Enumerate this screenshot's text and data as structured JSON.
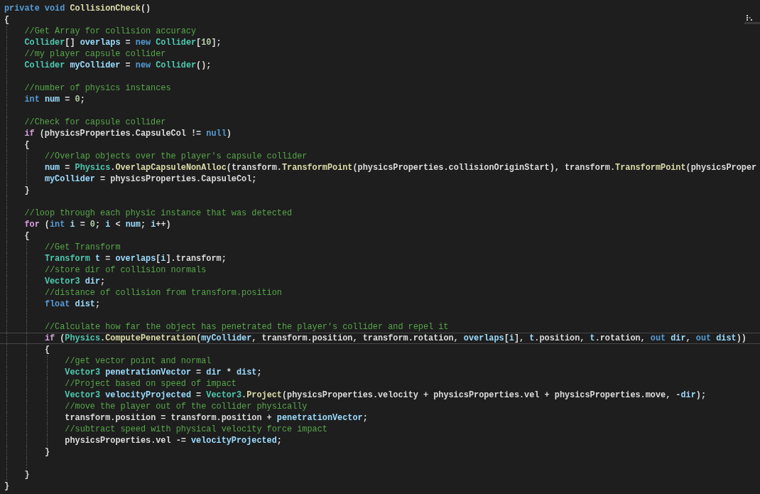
{
  "editor": {
    "lines": [
      {
        "current": false,
        "tokens": [
          {
            "kind": "keyword",
            "text": "private void "
          },
          {
            "kind": "method",
            "text": "CollisionCheck"
          },
          {
            "kind": "plain",
            "text": "()"
          }
        ]
      },
      {
        "current": false,
        "tokens": [
          {
            "kind": "plain",
            "text": "{"
          }
        ],
        "children": [
          {
            "current": false,
            "tokens": [
              {
                "kind": "comment",
                "text": "//Get Array for collision accuracy"
              }
            ]
          },
          {
            "current": false,
            "tokens": [
              {
                "kind": "type",
                "text": "Collider"
              },
              {
                "kind": "plain",
                "text": "[] "
              },
              {
                "kind": "variable",
                "text": "overlaps"
              },
              {
                "kind": "plain",
                "text": " = "
              },
              {
                "kind": "keyword",
                "text": "new "
              },
              {
                "kind": "type",
                "text": "Collider"
              },
              {
                "kind": "plain",
                "text": "["
              },
              {
                "kind": "number",
                "text": "10"
              },
              {
                "kind": "plain",
                "text": "];"
              }
            ]
          },
          {
            "current": false,
            "tokens": [
              {
                "kind": "comment",
                "text": "//my player capsule collider"
              }
            ]
          },
          {
            "current": false,
            "tokens": [
              {
                "kind": "type",
                "text": "Collider "
              },
              {
                "kind": "variable",
                "text": "myCollider"
              },
              {
                "kind": "plain",
                "text": " = "
              },
              {
                "kind": "keyword",
                "text": "new "
              },
              {
                "kind": "type",
                "text": "Collider"
              },
              {
                "kind": "plain",
                "text": "();"
              }
            ]
          },
          {
            "current": false
          },
          {
            "current": false,
            "tokens": [
              {
                "kind": "comment",
                "text": "//number of physics instances"
              }
            ]
          },
          {
            "current": false,
            "tokens": [
              {
                "kind": "keyword",
                "text": "int "
              },
              {
                "kind": "variable",
                "text": "num"
              },
              {
                "kind": "plain",
                "text": " = "
              },
              {
                "kind": "number",
                "text": "0"
              },
              {
                "kind": "plain",
                "text": ";"
              }
            ]
          },
          {
            "current": false
          },
          {
            "current": false,
            "tokens": [
              {
                "kind": "comment",
                "text": "//Check for capsule collider"
              }
            ]
          },
          {
            "current": false,
            "tokens": [
              {
                "kind": "control",
                "text": "if"
              },
              {
                "kind": "plain",
                "text": " (physicsProperties.CapsuleCol != "
              },
              {
                "kind": "keyword",
                "text": "null"
              },
              {
                "kind": "plain",
                "text": ")"
              }
            ]
          },
          {
            "current": false,
            "tokens": [
              {
                "kind": "plain",
                "text": "{"
              }
            ],
            "children": [
              {
                "current": false,
                "tokens": [
                  {
                    "kind": "comment",
                    "text": "//Overlap objects over the player's capsule collider"
                  }
                ]
              },
              {
                "current": false,
                "tokens": [
                  {
                    "kind": "variable",
                    "text": "num"
                  },
                  {
                    "kind": "plain",
                    "text": " = "
                  },
                  {
                    "kind": "type",
                    "text": "Physics"
                  },
                  {
                    "kind": "plain",
                    "text": "."
                  },
                  {
                    "kind": "method",
                    "text": "OverlapCapsuleNonAlloc"
                  },
                  {
                    "kind": "plain",
                    "text": "(transform."
                  },
                  {
                    "kind": "method",
                    "text": "TransformPoint"
                  },
                  {
                    "kind": "plain",
                    "text": "(physicsProperties.collisionOriginStart), transform."
                  },
                  {
                    "kind": "method",
                    "text": "TransformPoint"
                  },
                  {
                    "kind": "plain",
                    "text": "(physicsProper"
                  }
                ]
              },
              {
                "current": false,
                "tokens": [
                  {
                    "kind": "variable",
                    "text": "myCollider"
                  },
                  {
                    "kind": "plain",
                    "text": " = physicsProperties.CapsuleCol;"
                  }
                ]
              }
            ]
          },
          {
            "current": false,
            "tokens": [
              {
                "kind": "plain",
                "text": "}"
              }
            ]
          },
          {
            "current": false
          },
          {
            "current": false,
            "tokens": [
              {
                "kind": "comment",
                "text": "//loop through each physic instance that was detected"
              }
            ]
          },
          {
            "current": false,
            "tokens": [
              {
                "kind": "control",
                "text": "for"
              },
              {
                "kind": "plain",
                "text": " ("
              },
              {
                "kind": "keyword",
                "text": "int "
              },
              {
                "kind": "variable",
                "text": "i"
              },
              {
                "kind": "plain",
                "text": " = "
              },
              {
                "kind": "number",
                "text": "0"
              },
              {
                "kind": "plain",
                "text": "; "
              },
              {
                "kind": "variable",
                "text": "i"
              },
              {
                "kind": "plain",
                "text": " < "
              },
              {
                "kind": "variable",
                "text": "num"
              },
              {
                "kind": "plain",
                "text": "; "
              },
              {
                "kind": "variable",
                "text": "i"
              },
              {
                "kind": "plain",
                "text": "++)"
              }
            ]
          },
          {
            "current": false,
            "tokens": [
              {
                "kind": "plain",
                "text": "{"
              }
            ],
            "children": [
              {
                "current": false,
                "tokens": [
                  {
                    "kind": "comment",
                    "text": "//Get Transform"
                  }
                ]
              },
              {
                "current": false,
                "tokens": [
                  {
                    "kind": "type",
                    "text": "Transform "
                  },
                  {
                    "kind": "variable",
                    "text": "t"
                  },
                  {
                    "kind": "plain",
                    "text": " = "
                  },
                  {
                    "kind": "variable",
                    "text": "overlaps"
                  },
                  {
                    "kind": "plain",
                    "text": "["
                  },
                  {
                    "kind": "variable",
                    "text": "i"
                  },
                  {
                    "kind": "plain",
                    "text": "].transform;"
                  }
                ]
              },
              {
                "current": false,
                "tokens": [
                  {
                    "kind": "comment",
                    "text": "//store dir of collision normals"
                  }
                ]
              },
              {
                "current": false,
                "tokens": [
                  {
                    "kind": "type",
                    "text": "Vector3 "
                  },
                  {
                    "kind": "variable",
                    "text": "dir"
                  },
                  {
                    "kind": "plain",
                    "text": ";"
                  }
                ]
              },
              {
                "current": false,
                "tokens": [
                  {
                    "kind": "comment",
                    "text": "//distance of collision from transform.position"
                  }
                ]
              },
              {
                "current": false,
                "tokens": [
                  {
                    "kind": "keyword",
                    "text": "float "
                  },
                  {
                    "kind": "variable",
                    "text": "dist"
                  },
                  {
                    "kind": "plain",
                    "text": ";"
                  }
                ]
              },
              {
                "current": false
              },
              {
                "current": false,
                "tokens": [
                  {
                    "kind": "comment",
                    "text": "//Calculate how far the object has penetrated the player's collider and repel it"
                  }
                ]
              },
              {
                "current": true,
                "tokens": [
                  {
                    "kind": "control",
                    "text": "if"
                  },
                  {
                    "kind": "plain",
                    "text": " ("
                  },
                  {
                    "kind": "type",
                    "text": "Physics"
                  },
                  {
                    "kind": "plain",
                    "text": "."
                  },
                  {
                    "kind": "method",
                    "text": "ComputePenetration"
                  },
                  {
                    "kind": "plain",
                    "text": "("
                  },
                  {
                    "kind": "variable",
                    "text": "myCollider"
                  },
                  {
                    "kind": "plain",
                    "text": ", transform.position, transform.rotation, "
                  },
                  {
                    "kind": "variable",
                    "text": "overlaps"
                  },
                  {
                    "kind": "plain",
                    "text": "["
                  },
                  {
                    "kind": "variable",
                    "text": "i"
                  },
                  {
                    "kind": "plain",
                    "text": "], "
                  },
                  {
                    "kind": "variable",
                    "text": "t"
                  },
                  {
                    "kind": "plain",
                    "text": ".position, "
                  },
                  {
                    "kind": "variable",
                    "text": "t"
                  },
                  {
                    "kind": "plain",
                    "text": ".rotation, "
                  },
                  {
                    "kind": "keyword",
                    "text": "out "
                  },
                  {
                    "kind": "variable",
                    "text": "dir"
                  },
                  {
                    "kind": "plain",
                    "text": ", "
                  },
                  {
                    "kind": "keyword",
                    "text": "out "
                  },
                  {
                    "kind": "variable",
                    "text": "dist"
                  },
                  {
                    "kind": "plain",
                    "text": "))"
                  }
                ]
              },
              {
                "current": false,
                "tokens": [
                  {
                    "kind": "plain",
                    "text": "{"
                  }
                ],
                "children": [
                  {
                    "current": false,
                    "tokens": [
                      {
                        "kind": "comment",
                        "text": "//get vector point and normal"
                      }
                    ]
                  },
                  {
                    "current": false,
                    "tokens": [
                      {
                        "kind": "type",
                        "text": "Vector3 "
                      },
                      {
                        "kind": "variable",
                        "text": "penetrationVector"
                      },
                      {
                        "kind": "plain",
                        "text": " = "
                      },
                      {
                        "kind": "variable",
                        "text": "dir"
                      },
                      {
                        "kind": "plain",
                        "text": " * "
                      },
                      {
                        "kind": "variable",
                        "text": "dist"
                      },
                      {
                        "kind": "plain",
                        "text": ";"
                      }
                    ]
                  },
                  {
                    "current": false,
                    "tokens": [
                      {
                        "kind": "comment",
                        "text": "//Project based on speed of impact"
                      }
                    ]
                  },
                  {
                    "current": false,
                    "tokens": [
                      {
                        "kind": "type",
                        "text": "Vector3 "
                      },
                      {
                        "kind": "variable",
                        "text": "velocityProjected"
                      },
                      {
                        "kind": "plain",
                        "text": " = "
                      },
                      {
                        "kind": "type",
                        "text": "Vector3"
                      },
                      {
                        "kind": "plain",
                        "text": "."
                      },
                      {
                        "kind": "method",
                        "text": "Project"
                      },
                      {
                        "kind": "plain",
                        "text": "(physicsProperties.velocity + physicsProperties.vel + physicsProperties.move, -"
                      },
                      {
                        "kind": "variable",
                        "text": "dir"
                      },
                      {
                        "kind": "plain",
                        "text": ");"
                      }
                    ]
                  },
                  {
                    "current": false,
                    "tokens": [
                      {
                        "kind": "comment",
                        "text": "//move the player out of the collider physically"
                      }
                    ]
                  },
                  {
                    "current": false,
                    "tokens": [
                      {
                        "kind": "plain",
                        "text": "transform.position = transform.position + "
                      },
                      {
                        "kind": "variable",
                        "text": "penetrationVector"
                      },
                      {
                        "kind": "plain",
                        "text": ";"
                      }
                    ]
                  },
                  {
                    "current": false,
                    "tokens": [
                      {
                        "kind": "comment",
                        "text": "//subtract speed with physical velocity force impact"
                      }
                    ]
                  },
                  {
                    "current": false,
                    "tokens": [
                      {
                        "kind": "plain",
                        "text": "physicsProperties.vel -= "
                      },
                      {
                        "kind": "variable",
                        "text": "velocityProjected"
                      },
                      {
                        "kind": "plain",
                        "text": ";"
                      }
                    ]
                  }
                ]
              },
              {
                "current": false,
                "tokens": [
                  {
                    "kind": "plain",
                    "text": "}"
                  }
                ]
              },
              {
                "current": false
              }
            ]
          },
          {
            "current": false,
            "tokens": [
              {
                "kind": "plain",
                "text": "}"
              }
            ]
          }
        ]
      },
      {
        "current": false,
        "tokens": [
          {
            "kind": "plain",
            "text": "}"
          }
        ]
      }
    ]
  }
}
